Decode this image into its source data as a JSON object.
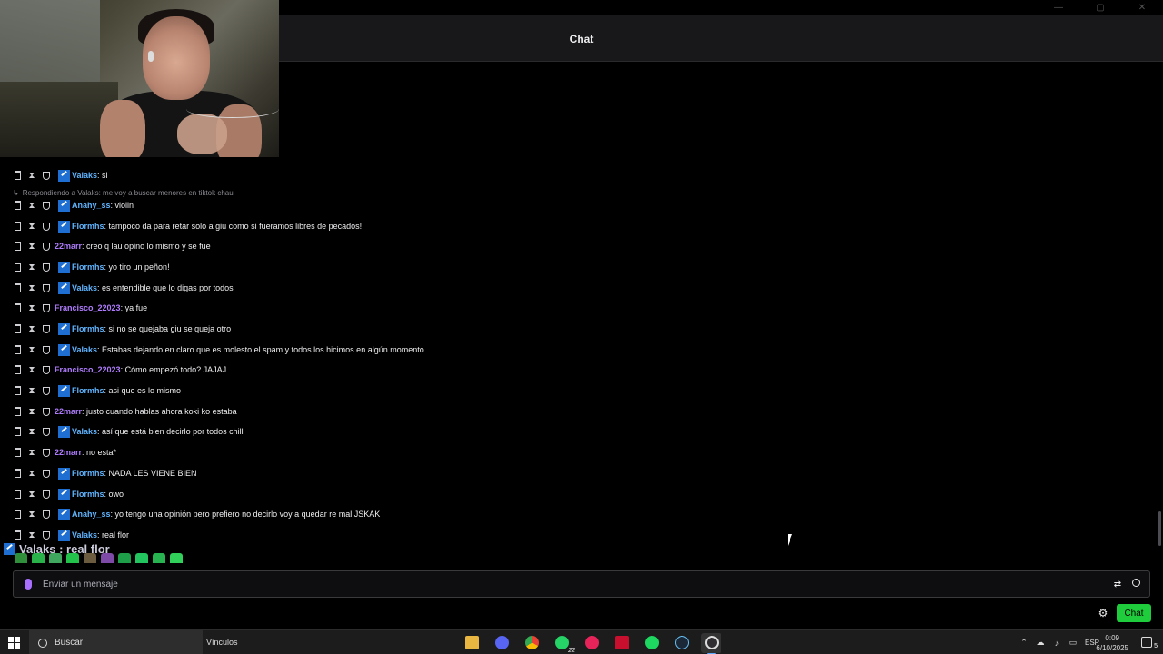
{
  "window": {
    "minimize": "—",
    "maximize": "▢",
    "close": "✕"
  },
  "header": {
    "title": "Chat"
  },
  "reply": {
    "text": "Respondiendo a Valaks: me voy a buscar menores en tiktok chau"
  },
  "messages": [
    {
      "user": "Valaks",
      "text": ": si",
      "color": "#5fb4ff",
      "badge": true
    },
    {
      "user": "Anahy_ss",
      "text": ": violin",
      "color": "#5fb4ff",
      "badge": true
    },
    {
      "user": "Flormhs",
      "text": ": tampoco da para retar solo a giu como si fueramos libres de pecados!",
      "color": "#5fb4ff",
      "badge": true
    },
    {
      "user": "22marr",
      "text": ": creo q lau opino lo mismo y se fue",
      "color": "#b07cff",
      "badge": false
    },
    {
      "user": "Flormhs",
      "text": ": yo tiro un peñon!",
      "color": "#5fb4ff",
      "badge": true
    },
    {
      "user": "Valaks",
      "text": ": es entendible que lo digas por todos",
      "color": "#5fb4ff",
      "badge": true
    },
    {
      "user": "Francisco_22023",
      "text": ": ya fue",
      "color": "#b07cff",
      "badge": false
    },
    {
      "user": "Flormhs",
      "text": ": si no se quejaba giu se queja otro",
      "color": "#5fb4ff",
      "badge": true
    },
    {
      "user": "Valaks",
      "text": ": Estabas dejando en claro que es molesto el spam y todos los hicimos en algún momento",
      "color": "#5fb4ff",
      "badge": true
    },
    {
      "user": "Francisco_22023",
      "text": ": Cómo empezó todo? JAJAJ",
      "color": "#b07cff",
      "badge": false
    },
    {
      "user": "Flormhs",
      "text": ": asi que es lo mismo",
      "color": "#5fb4ff",
      "badge": true
    },
    {
      "user": "22marr",
      "text": ": justo cuando hablas ahora koki ko estaba",
      "color": "#b07cff",
      "badge": false
    },
    {
      "user": "Valaks",
      "text": ": así que está bien decirlo por todos chill",
      "color": "#5fb4ff",
      "badge": true
    },
    {
      "user": "22marr",
      "text": ": no esta*",
      "color": "#b07cff",
      "badge": false
    },
    {
      "user": "Flormhs",
      "text": ": NADA LES VIENE BIEN",
      "color": "#5fb4ff",
      "badge": true
    },
    {
      "user": "Flormhs",
      "text": ": owo",
      "color": "#5fb4ff",
      "badge": true
    },
    {
      "user": "Anahy_ss",
      "text": ": yo tengo una opinión pero prefiero no decirlo voy a quedar re mal JSKAK",
      "color": "#5fb4ff",
      "badge": true
    },
    {
      "user": "Valaks",
      "text": ": real flor",
      "color": "#5fb4ff",
      "badge": true
    }
  ],
  "latest_overlay": {
    "text": "Valaks : real flor"
  },
  "input": {
    "placeholder": "Enviar un mensaje"
  },
  "actions": {
    "chat_button": "Chat"
  },
  "taskbar": {
    "search_placeholder": "Buscar",
    "links_label": "Vínculos",
    "whatsapp_count": "22",
    "language": "ESP",
    "time": "0:09",
    "date": "6/10/2025",
    "notifications": "5"
  }
}
